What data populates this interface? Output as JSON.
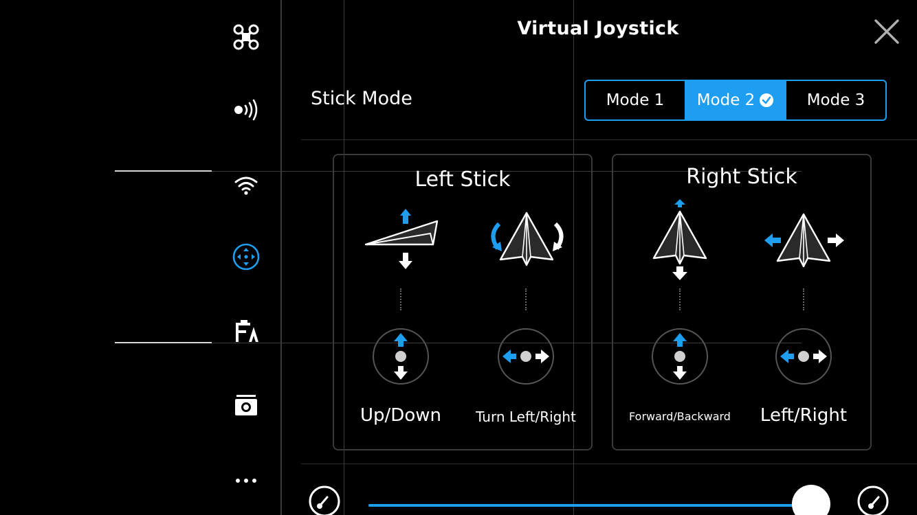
{
  "header": {
    "title": "Virtual Joystick"
  },
  "sidebar": {
    "items": [
      {
        "name": "aircraft-icon",
        "active": false
      },
      {
        "name": "signal-icon",
        "active": false
      },
      {
        "name": "wifi-icon",
        "active": false
      },
      {
        "name": "joystick-icon",
        "active": true
      },
      {
        "name": "font-icon",
        "active": false
      },
      {
        "name": "camera-icon",
        "active": false
      },
      {
        "name": "more-icon",
        "active": false
      }
    ]
  },
  "stick_mode": {
    "label": "Stick Mode",
    "modes": [
      "Mode 1",
      "Mode 2",
      "Mode 3"
    ],
    "selected": "Mode 2"
  },
  "left_stick": {
    "title": "Left Stick",
    "controls": [
      {
        "label": "Up/Down"
      },
      {
        "label": "Turn Left/Right"
      }
    ]
  },
  "right_stick": {
    "title": "Right Stick",
    "controls": [
      {
        "label": "Forward/Backward"
      },
      {
        "label": "Left/Right"
      }
    ]
  },
  "speed": {
    "level": 1.0
  },
  "colors": {
    "accent": "#1e9ef0",
    "background": "#000000",
    "text": "#ffffff"
  }
}
